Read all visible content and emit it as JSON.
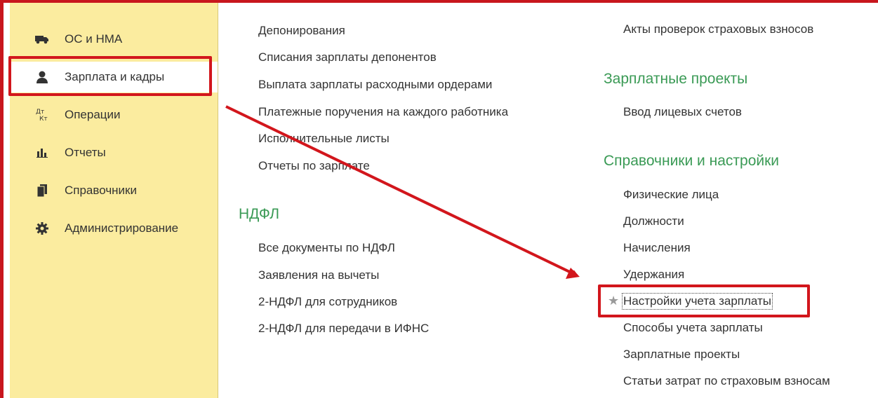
{
  "sidebar": {
    "items": [
      {
        "label": "ОС и НМА",
        "icon": "truck-icon"
      },
      {
        "label": "Зарплата и кадры",
        "icon": "person-icon"
      },
      {
        "label": "Операции",
        "icon": "dt-kt-icon"
      },
      {
        "label": "Отчеты",
        "icon": "bar-chart-icon"
      },
      {
        "label": "Справочники",
        "icon": "books-icon"
      },
      {
        "label": "Администрирование",
        "icon": "gear-icon"
      }
    ],
    "active_index": 1
  },
  "column1": {
    "links": [
      "Депонирования",
      "Списания зарплаты депонентов",
      "Выплата зарплаты расходными ордерами",
      "Платежные поручения на каждого работника",
      "Исполнительные листы",
      "Отчеты по зарплате"
    ],
    "ndfl_section": {
      "title": "НДФЛ",
      "links": [
        "Все документы по НДФЛ",
        "Заявления на вычеты",
        "2-НДФЛ для сотрудников",
        "2-НДФЛ для передачи в ИФНС"
      ]
    }
  },
  "column2": {
    "top_link": "Акты проверок страховых взносов",
    "salary_projects": {
      "title": "Зарплатные проекты",
      "links": [
        "Ввод лицевых счетов"
      ]
    },
    "settings": {
      "title": "Справочники и настройки",
      "links": [
        "Физические лица",
        "Должности",
        "Начисления",
        "Удержания",
        "Настройки учета зарплаты",
        "Способы учета зарплаты",
        "Зарплатные проекты",
        "Статьи затрат по страховым взносам"
      ],
      "highlighted_link": "Настройки учета зарплаты",
      "highlight_marker": "★"
    }
  },
  "colors": {
    "sidebar_bg": "#fbec9f",
    "section_title": "#3a9a55",
    "annotation_red": "#d2161c"
  }
}
